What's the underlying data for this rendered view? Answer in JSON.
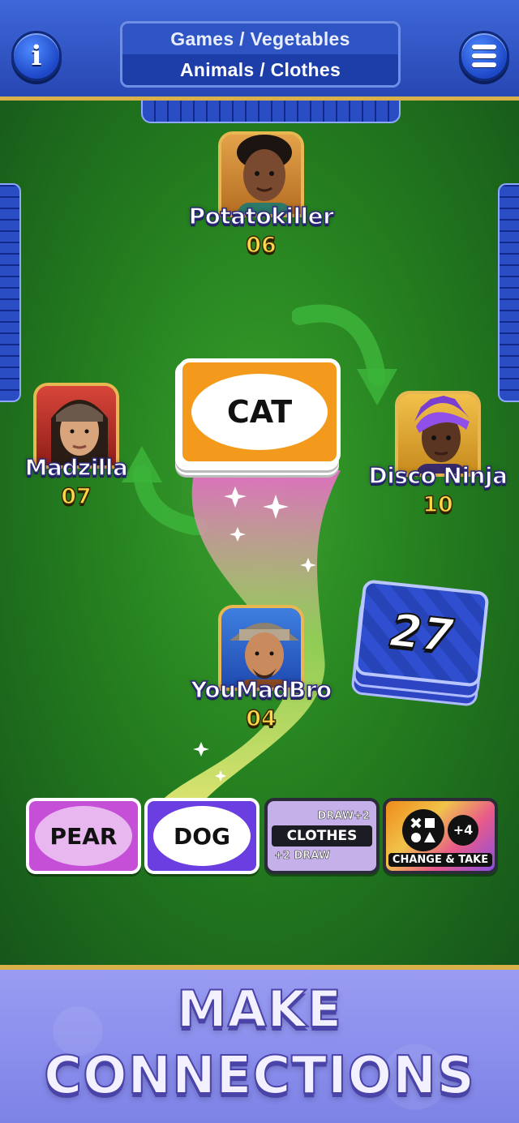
{
  "header": {
    "info_icon": "info-icon",
    "menu_icon": "hamburger-menu-icon",
    "categories_line1": "Games / Vegetables",
    "categories_line2": "Animals / Clothes"
  },
  "players": {
    "top": {
      "name": "Potatokiller",
      "count": "06"
    },
    "left": {
      "name": "Madzilla",
      "count": "07"
    },
    "right": {
      "name": "Disco Ninja",
      "count": "10"
    },
    "you": {
      "name": "YouMadBro",
      "count": "04"
    }
  },
  "center_card": {
    "word": "CAT",
    "color": "#f39a1d"
  },
  "draw_deck": {
    "count": "27"
  },
  "hand": {
    "cards": [
      {
        "word": "PEAR",
        "color": "#c64fd8"
      },
      {
        "word": "DOG",
        "color": "#6a3ee0"
      }
    ],
    "draw_card": {
      "top_text": "DRAW+2",
      "category": "CLOTHES",
      "bottom_text": "+2 DRAW"
    },
    "wild_card": {
      "badge": "+4",
      "label": "CHANGE & TAKE"
    }
  },
  "banner": {
    "line1": "MAKE",
    "line2": "CONNECTIONS"
  },
  "colors": {
    "header_blue": "#2f55c4",
    "table_green": "#25801f",
    "gold": "#d9b04a",
    "banner_purple": "#8b8fee"
  }
}
